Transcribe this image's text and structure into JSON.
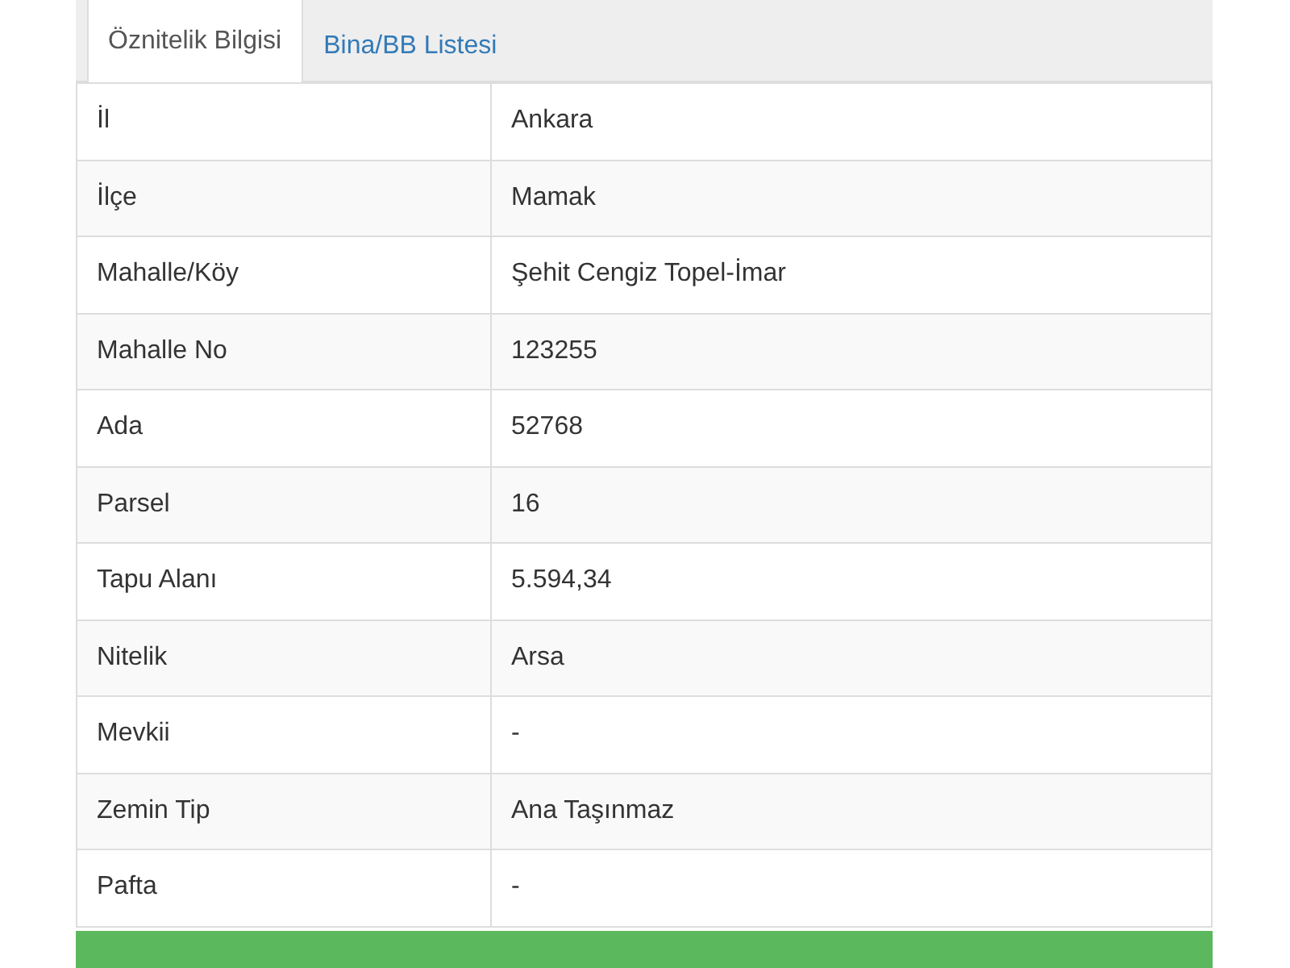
{
  "tabs": [
    {
      "label": "Öznitelik Bilgisi",
      "selected": true
    },
    {
      "label": "Bina/BB Listesi",
      "selected": false
    }
  ],
  "table": {
    "rows": [
      {
        "label": "İl",
        "value": "Ankara"
      },
      {
        "label": "İlçe",
        "value": "Mamak"
      },
      {
        "label": "Mahalle/Köy",
        "value": "Şehit Cengiz Topel-İmar"
      },
      {
        "label": "Mahalle No",
        "value": "123255"
      },
      {
        "label": "Ada",
        "value": "52768"
      },
      {
        "label": "Parsel",
        "value": "16"
      },
      {
        "label": "Tapu Alanı",
        "value": "5.594,34"
      },
      {
        "label": "Nitelik",
        "value": "Arsa"
      },
      {
        "label": "Mevkii",
        "value": "-"
      },
      {
        "label": "Zemin Tip",
        "value": "Ana Taşınmaz"
      },
      {
        "label": "Pafta",
        "value": "-"
      }
    ]
  }
}
